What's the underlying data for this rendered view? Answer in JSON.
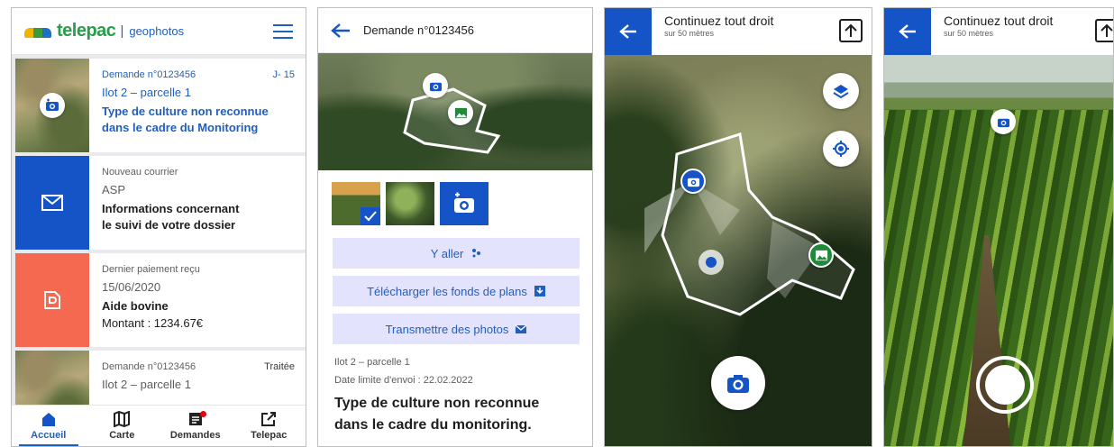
{
  "screen1": {
    "logo": {
      "name": "telepac",
      "separator": "|",
      "sub": "geophotos"
    },
    "cards": [
      {
        "meta": "Demande n°0123456",
        "tag": "J- 15",
        "line": "Ilot 2 – parcelle 1",
        "title1": "Type de culture non reconnue",
        "title2": "dans le cadre du Monitoring"
      },
      {
        "meta": "Nouveau courrier",
        "line": "ASP",
        "title1": "Informations concernant",
        "title2": "le suivi de votre dossier"
      },
      {
        "meta": "Dernier paiement reçu",
        "line": "15/06/2020",
        "title1": "Aide bovine",
        "title2": "Montant : 1234.67€"
      },
      {
        "meta": "Demande n°0123456",
        "tag": "Traitée",
        "line": "Ilot 2 – parcelle 1"
      }
    ],
    "nav": [
      "Accueil",
      "Carte",
      "Demandes",
      "Telepac"
    ]
  },
  "screen2": {
    "title": "Demande n°0123456",
    "buttons": {
      "go": "Y aller",
      "download": "Télécharger les fonds de plans",
      "send": "Transmettre des photos"
    },
    "info": {
      "parcel": "Ilot 2 – parcelle 1",
      "deadline": "Date limite d'envoi : 22.02.2022",
      "headline1": "Type  de culture non reconnue",
      "headline2": "dans le cadre du monitoring."
    }
  },
  "screen3": {
    "instruction": "Continuez tout droit",
    "distance": "sur 50 mètres"
  },
  "screen4": {
    "instruction": "Continuez tout droit",
    "distance": "sur 50 mètres"
  },
  "colors": {
    "primary": "#1454c6",
    "text_blue": "#1f5fbf",
    "accent_orange": "#f4694f",
    "button_bg": "#e3e3fd",
    "photo_green": "#1f8a3a",
    "badge_red": "#e1000f"
  },
  "icons": [
    "camera-icon",
    "mail-icon",
    "payment-icon",
    "home-icon",
    "map-icon",
    "document-icon",
    "external-link-icon",
    "arrow-left-icon",
    "arrow-up-icon",
    "layers-icon",
    "locate-icon",
    "image-icon",
    "check-icon",
    "hamburger-icon",
    "walk-icon",
    "download-icon"
  ]
}
